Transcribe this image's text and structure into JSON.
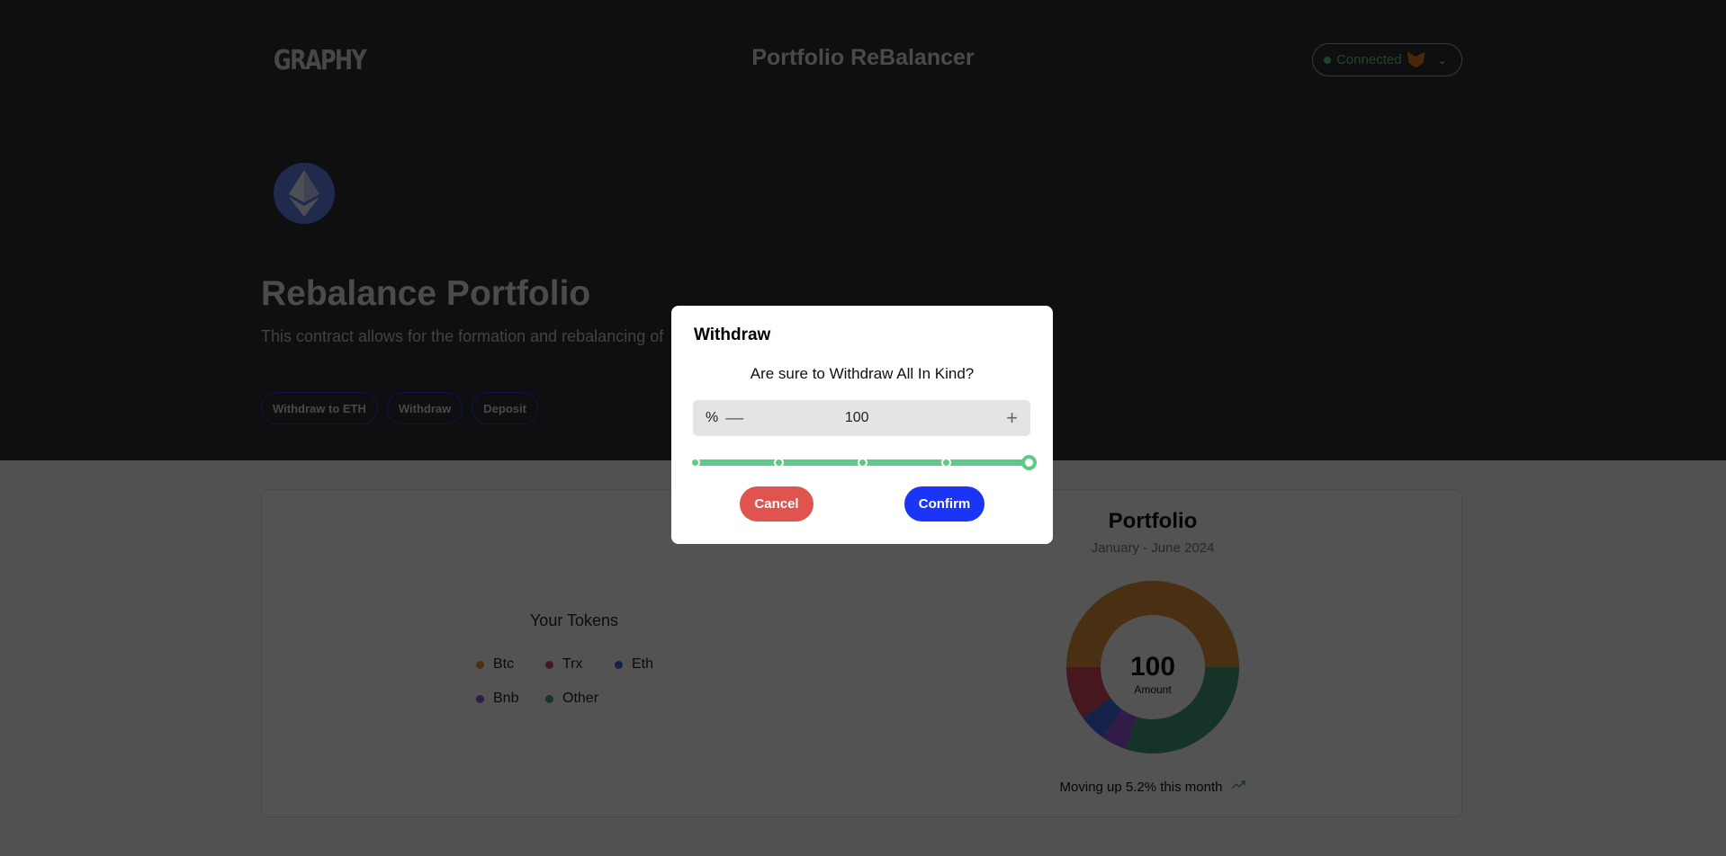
{
  "header": {
    "logo": "GRAPHY",
    "title": "Portfolio ReBalancer",
    "wallet_status": "Connected",
    "status_color": "#5fcf7a"
  },
  "hero": {
    "title": "Rebalance Portfolio",
    "description": "This contract allows for the formation and rebalancing of",
    "buttons": [
      "Withdraw to ETH",
      "Withdraw",
      "Deposit"
    ]
  },
  "tokens": {
    "title": "Your Tokens",
    "legend": [
      {
        "label": "Btc",
        "color": "#e0913a"
      },
      {
        "label": "Trx",
        "color": "#d4455f"
      },
      {
        "label": "Eth",
        "color": "#3c68e0"
      },
      {
        "label": "Bnb",
        "color": "#9452d8"
      },
      {
        "label": "Other",
        "color": "#3f9a72"
      }
    ]
  },
  "portfolio": {
    "title": "Portfolio",
    "subtitle": "January - June 2024",
    "center_value": "100",
    "center_label": "Amount",
    "footer": "Moving up 5.2% this month",
    "trend_icon": "trending-up-icon"
  },
  "chart_data": {
    "type": "pie",
    "categories": [
      "Btc",
      "Other",
      "Bnb",
      "Eth",
      "Trx"
    ],
    "values": [
      50,
      30,
      5,
      5,
      10
    ],
    "colors": [
      "#e0913a",
      "#3f9a72",
      "#9452d8",
      "#3c68e0",
      "#d4455f"
    ]
  },
  "modal": {
    "title": "Withdraw",
    "question": "Are sure to Withdraw All In Kind?",
    "unit": "%",
    "value": "100",
    "slider_percent": 100,
    "slider_steps": [
      0,
      25,
      50,
      75,
      100
    ],
    "cancel": "Cancel",
    "confirm": "Confirm"
  }
}
